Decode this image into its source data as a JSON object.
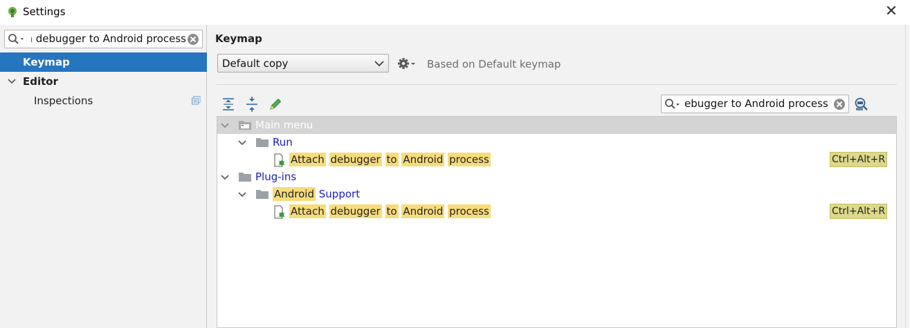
{
  "window": {
    "title": "Settings",
    "close_glyph": "✕"
  },
  "left": {
    "search_value": "Attach debugger to Android process",
    "tree": {
      "keymap": "Keymap",
      "editor": "Editor",
      "inspections": "Inspections"
    }
  },
  "right": {
    "heading": "Keymap",
    "keymap_combo": "Default copy",
    "based_on": "Based on Default keymap",
    "search_value": "ebugger to Android process"
  },
  "keymap_tree": {
    "main_menu": "Main menu",
    "run": "Run",
    "action_words": [
      "Attach",
      "debugger",
      "to",
      "Android",
      "process"
    ],
    "plugins": "Plug-ins",
    "android_support_first": "Android",
    "android_support_second": "Support",
    "shortcut": "Ctrl+Alt+R"
  },
  "colors": {
    "selection": "#2675bf",
    "highlight": "#f7dc7c",
    "shortcut_bg": "#dcd98c",
    "link_blue": "#1a1ac4"
  },
  "icons": [
    "android-studio-icon",
    "close-icon",
    "search-icon",
    "clear-icon",
    "copy-icon",
    "chevron-down-icon",
    "gear-icon",
    "expand-all-icon",
    "collapse-all-icon",
    "edit-pencil-icon",
    "folder-icon",
    "menu-folder-icon",
    "debug-action-icon",
    "find-shortcut-icon"
  ]
}
